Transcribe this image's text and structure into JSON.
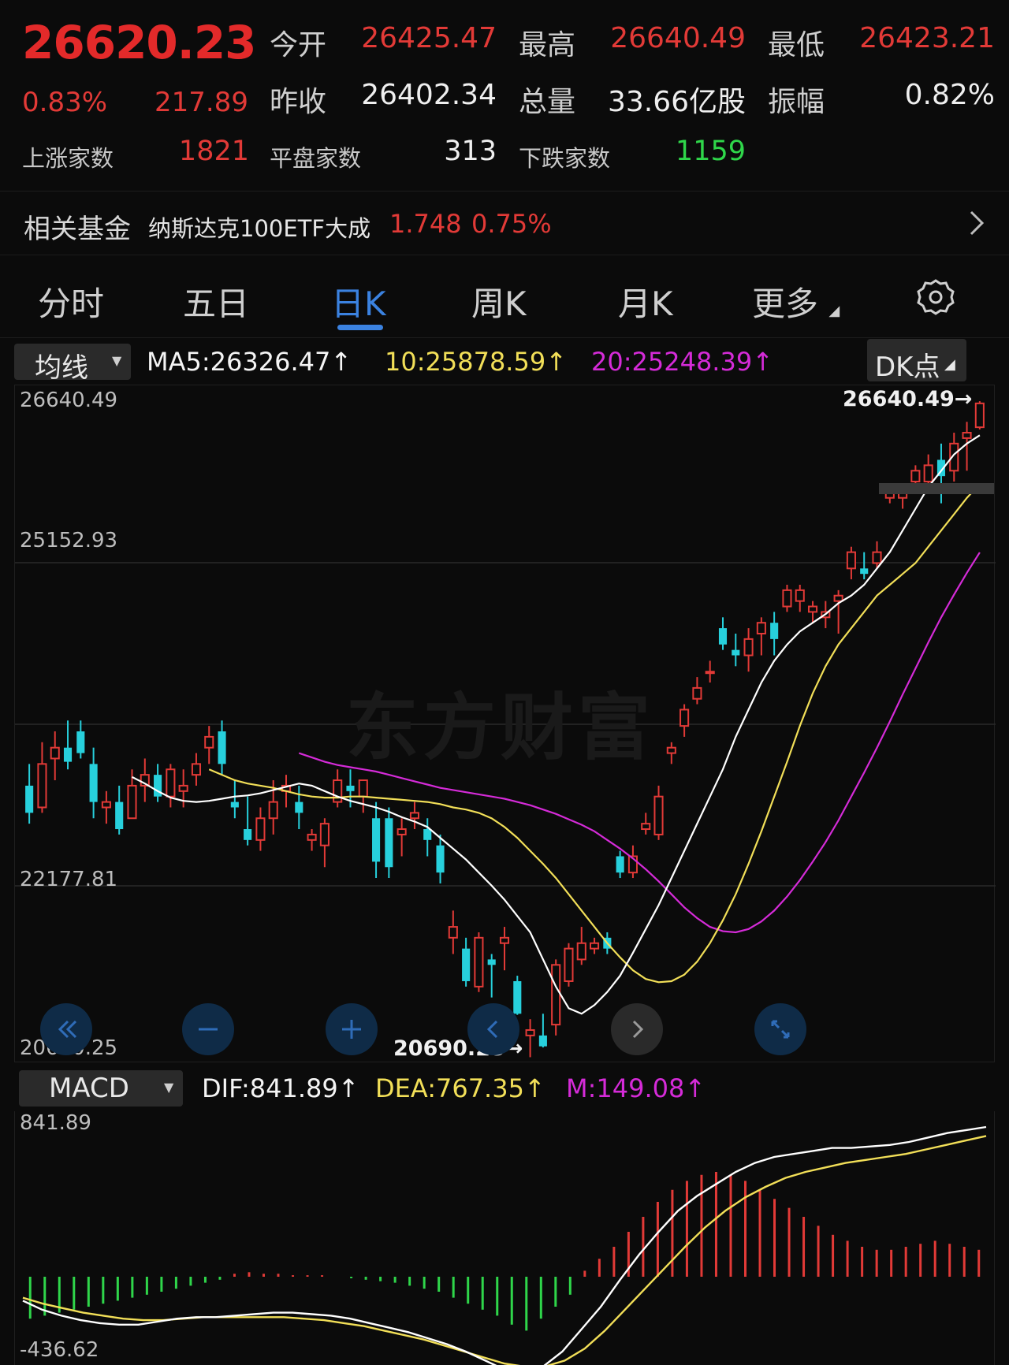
{
  "quote": {
    "price": "26620.23",
    "change_pct": "0.83%",
    "change": "217.89",
    "open_label": "今开",
    "open": "26425.47",
    "high_label": "最高",
    "high": "26640.49",
    "low_label": "最低",
    "low": "26423.21",
    "prev_close_label": "昨收",
    "prev_close": "26402.34",
    "volume_label": "总量",
    "volume": "33.66亿股",
    "amplitude_label": "振幅",
    "amplitude": "0.82%",
    "up_label": "上涨家数",
    "up": "1821",
    "flat_label": "平盘家数",
    "flat": "313",
    "down_label": "下跌家数",
    "down": "1159"
  },
  "fund": {
    "label": "相关基金",
    "name": "纳斯达克100ETF大成",
    "price": "1.748",
    "pct": "0.75%"
  },
  "tabs": [
    "分时",
    "五日",
    "日K",
    "周K",
    "月K",
    "更多"
  ],
  "active_tab": "日K",
  "ma_bar": {
    "select": "均线",
    "ma5": "MA5:26326.47↑",
    "ma10": "10:25878.59↑",
    "ma20": "20:25248.39↑",
    "dk": "DK点"
  },
  "kchart_axis": {
    "top": "26640.49",
    "mid1": "25152.93",
    "mid2": "22177.81",
    "bottom": "20690.25",
    "max_marker": "26640.49→",
    "min_marker": "20690.25→"
  },
  "macd_bar": {
    "select": "MACD",
    "dif": "DIF:841.89↑",
    "dea": "DEA:767.35↑",
    "m": "M:149.08↑"
  },
  "macd_axis": {
    "top": "841.89",
    "bottom": "-436.62"
  },
  "watermark": "东方财富",
  "colors": {
    "up": "#e23a37",
    "down": "#27d0dc",
    "ma5": "#ffffff",
    "ma10": "#f2df58",
    "ma20": "#d52bd8",
    "accent": "#3b82e0"
  },
  "chart_data": [
    {
      "type": "candlestick",
      "ylim": [
        20690.25,
        26640.49
      ],
      "candles": [
        [
          23100,
          23300,
          22750,
          22850
        ],
        [
          22900,
          23500,
          22850,
          23300
        ],
        [
          23350,
          23600,
          23150,
          23450
        ],
        [
          23450,
          23700,
          23250,
          23320
        ],
        [
          23600,
          23700,
          23350,
          23400
        ],
        [
          23300,
          23450,
          22800,
          22950
        ],
        [
          22900,
          23050,
          22750,
          22950
        ],
        [
          22950,
          23100,
          22650,
          22700
        ],
        [
          22800,
          23250,
          22800,
          23100
        ],
        [
          23100,
          23350,
          22950,
          23200
        ],
        [
          23200,
          23300,
          22950,
          23000
        ],
        [
          23000,
          23300,
          22900,
          23250
        ],
        [
          23050,
          23250,
          22900,
          23100
        ],
        [
          23200,
          23400,
          23100,
          23300
        ],
        [
          23450,
          23650,
          23300,
          23550
        ],
        [
          23600,
          23700,
          23200,
          23300
        ],
        [
          22950,
          23150,
          22800,
          22900
        ],
        [
          22700,
          23000,
          22550,
          22600
        ],
        [
          22600,
          22900,
          22500,
          22800
        ],
        [
          22800,
          23150,
          22650,
          22950
        ],
        [
          23050,
          23200,
          22900,
          23100
        ],
        [
          22950,
          23100,
          22700,
          22850
        ],
        [
          22600,
          22700,
          22500,
          22650
        ],
        [
          22550,
          22800,
          22350,
          22750
        ],
        [
          22950,
          23250,
          22900,
          23150
        ],
        [
          23100,
          23250,
          22900,
          23050
        ],
        [
          23000,
          23150,
          22850,
          23150
        ],
        [
          22800,
          22950,
          22250,
          22400
        ],
        [
          22800,
          22900,
          22250,
          22350
        ],
        [
          22650,
          22800,
          22450,
          22700
        ],
        [
          22800,
          22950,
          22700,
          22850
        ],
        [
          22700,
          22800,
          22450,
          22600
        ],
        [
          22550,
          22650,
          22200,
          22300
        ],
        [
          21700,
          21950,
          21550,
          21800
        ],
        [
          21600,
          21700,
          21250,
          21300
        ],
        [
          21250,
          21750,
          21200,
          21700
        ],
        [
          21500,
          21550,
          21150,
          21450
        ],
        [
          21650,
          21800,
          21400,
          21700
        ],
        [
          21300,
          21350,
          20990,
          21000
        ],
        [
          20800,
          20950,
          20600,
          20850
        ],
        [
          20800,
          21000,
          20690,
          20700
        ],
        [
          20900,
          21500,
          20800,
          21450
        ],
        [
          21300,
          21650,
          21250,
          21600
        ],
        [
          21500,
          21800,
          21450,
          21650
        ],
        [
          21600,
          21700,
          21550,
          21650
        ],
        [
          21700,
          21750,
          21550,
          21600
        ],
        [
          22450,
          22500,
          22250,
          22300
        ],
        [
          22300,
          22550,
          22250,
          22450
        ],
        [
          22700,
          22850,
          22650,
          22750
        ],
        [
          22650,
          23100,
          22600,
          23000
        ],
        [
          23400,
          23500,
          23300,
          23450
        ],
        [
          23650,
          23850,
          23550,
          23800
        ],
        [
          23900,
          24100,
          23850,
          24000
        ],
        [
          24150,
          24250,
          24050,
          24150
        ],
        [
          24550,
          24650,
          24350,
          24400
        ],
        [
          24350,
          24500,
          24200,
          24300
        ],
        [
          24300,
          24550,
          24150,
          24450
        ],
        [
          24500,
          24650,
          24300,
          24600
        ],
        [
          24600,
          24700,
          24300,
          24450
        ],
        [
          24750,
          24950,
          24700,
          24900
        ],
        [
          24800,
          24950,
          24700,
          24900
        ],
        [
          24700,
          24800,
          24600,
          24750
        ],
        [
          24650,
          24800,
          24550,
          24700
        ],
        [
          24800,
          24900,
          24500,
          24850
        ],
        [
          25100,
          25300,
          25000,
          25250
        ],
        [
          25100,
          25250,
          25000,
          25050
        ],
        [
          25150,
          25350,
          25100,
          25250
        ],
        [
          25750,
          25850,
          25700,
          25800
        ],
        [
          25750,
          25850,
          25650,
          25800
        ],
        [
          25900,
          26050,
          25800,
          26000
        ],
        [
          25900,
          26150,
          25850,
          26050
        ],
        [
          26100,
          26250,
          25700,
          25950
        ],
        [
          26000,
          26350,
          25900,
          26250
        ],
        [
          26300,
          26450,
          26000,
          26350
        ],
        [
          26400,
          26640,
          26380,
          26620
        ]
      ],
      "ma5": [
        23180,
        23120,
        23050,
        22990,
        22960,
        22950,
        22960,
        22980,
        23000,
        23010,
        23030,
        23060,
        23090,
        23120,
        23100,
        23050,
        23000,
        22960,
        22930,
        22900,
        22860,
        22810,
        22770,
        22720,
        22620,
        22520,
        22420,
        22300,
        22180,
        22050,
        21900,
        21750,
        21500,
        21250,
        21050,
        21000,
        21080,
        21200,
        21350,
        21560,
        21780,
        22000,
        22250,
        22500,
        22750,
        23000,
        23250,
        23550,
        23800,
        24050,
        24250,
        24400,
        24520,
        24600,
        24680,
        24780,
        24850,
        24950,
        25100,
        25250,
        25450,
        25650,
        25850,
        26000,
        26150,
        26250,
        26326
      ],
      "ma10": [
        23250,
        23200,
        23150,
        23120,
        23100,
        23080,
        23050,
        23020,
        23000,
        22990,
        22990,
        23000,
        23000,
        22990,
        22980,
        22970,
        22960,
        22950,
        22930,
        22900,
        22880,
        22850,
        22800,
        22720,
        22620,
        22500,
        22380,
        22250,
        22100,
        21950,
        21800,
        21650,
        21520,
        21400,
        21320,
        21290,
        21300,
        21360,
        21480,
        21650,
        21860,
        22100,
        22380,
        22680,
        23000,
        23320,
        23650,
        23950,
        24200,
        24400,
        24550,
        24700,
        24850,
        24950,
        25050,
        25150,
        25300,
        25450,
        25600,
        25750,
        25878
      ],
      "ma20": [
        23400,
        23360,
        23320,
        23290,
        23270,
        23250,
        23230,
        23200,
        23170,
        23140,
        23110,
        23080,
        23060,
        23040,
        23020,
        23000,
        22980,
        22950,
        22920,
        22880,
        22840,
        22790,
        22740,
        22680,
        22600,
        22520,
        22430,
        22330,
        22220,
        22100,
        21980,
        21880,
        21800,
        21760,
        21750,
        21780,
        21850,
        21950,
        22080,
        22230,
        22400,
        22580,
        22780,
        23000,
        23220,
        23450,
        23690,
        23940,
        24180,
        24420,
        24650,
        24860,
        25060,
        25248
      ]
    },
    {
      "type": "bar+line",
      "ylim": [
        -436.62,
        841.89
      ],
      "hist": [
        -0.28,
        -0.26,
        -0.24,
        -0.22,
        -0.2,
        -0.18,
        -0.16,
        -0.14,
        -0.12,
        -0.1,
        -0.08,
        -0.06,
        -0.04,
        -0.02,
        0.02,
        0.03,
        0.02,
        0.02,
        0.01,
        0.01,
        0.01,
        0.0,
        -0.01,
        -0.02,
        -0.03,
        -0.04,
        -0.06,
        -0.08,
        -0.1,
        -0.14,
        -0.18,
        -0.22,
        -0.26,
        -0.32,
        -0.36,
        -0.28,
        -0.2,
        -0.12,
        0.04,
        0.12,
        0.2,
        0.3,
        0.4,
        0.5,
        0.58,
        0.64,
        0.68,
        0.7,
        0.68,
        0.64,
        0.58,
        0.52,
        0.46,
        0.4,
        0.34,
        0.28,
        0.24,
        0.2,
        0.18,
        0.18,
        0.2,
        0.22,
        0.24,
        0.22,
        0.2,
        0.18
      ],
      "dif": [
        -0.16,
        -0.22,
        -0.26,
        -0.29,
        -0.31,
        -0.32,
        -0.32,
        -0.3,
        -0.28,
        -0.27,
        -0.27,
        -0.26,
        -0.25,
        -0.24,
        -0.24,
        -0.25,
        -0.26,
        -0.28,
        -0.31,
        -0.34,
        -0.37,
        -0.41,
        -0.45,
        -0.5,
        -0.56,
        -0.62,
        -0.64,
        -0.6,
        -0.5,
        -0.35,
        -0.2,
        -0.02,
        0.15,
        0.3,
        0.44,
        0.54,
        0.62,
        0.7,
        0.76,
        0.8,
        0.82,
        0.84,
        0.86,
        0.86,
        0.87,
        0.88,
        0.9,
        0.93,
        0.96,
        0.98,
        1.0
      ],
      "dea": [
        -0.14,
        -0.18,
        -0.21,
        -0.24,
        -0.26,
        -0.28,
        -0.29,
        -0.29,
        -0.28,
        -0.27,
        -0.27,
        -0.27,
        -0.27,
        -0.27,
        -0.28,
        -0.29,
        -0.31,
        -0.33,
        -0.36,
        -0.39,
        -0.42,
        -0.46,
        -0.5,
        -0.54,
        -0.58,
        -0.6,
        -0.6,
        -0.56,
        -0.48,
        -0.36,
        -0.22,
        -0.08,
        0.06,
        0.2,
        0.33,
        0.44,
        0.53,
        0.6,
        0.66,
        0.7,
        0.73,
        0.76,
        0.78,
        0.8,
        0.82,
        0.85,
        0.88,
        0.91,
        0.94
      ]
    }
  ]
}
